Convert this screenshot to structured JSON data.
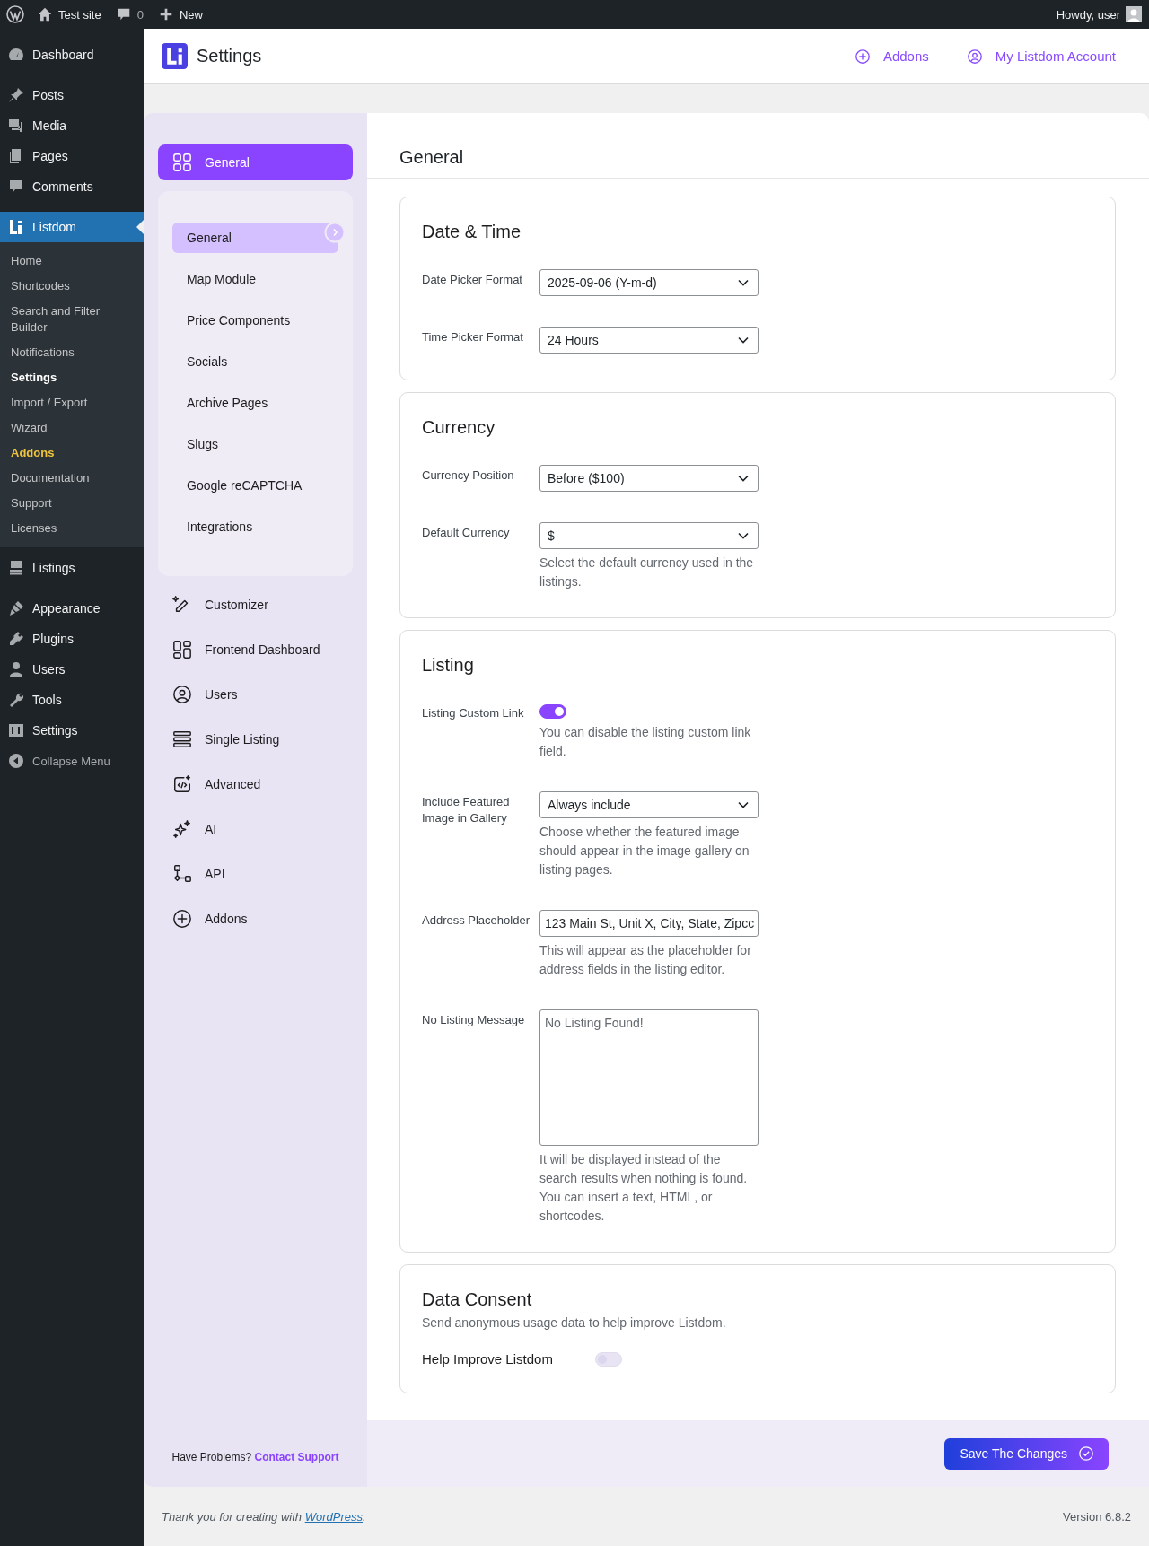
{
  "admin_bar": {
    "site": "Test site",
    "comments": "0",
    "new": "New",
    "greeting": "Howdy, user"
  },
  "admin_menu": [
    {
      "label": "Dashboard",
      "selected": false
    },
    {
      "label": "Posts",
      "selected": false
    },
    {
      "label": "Media",
      "selected": false
    },
    {
      "label": "Pages",
      "selected": false
    },
    {
      "label": "Comments",
      "selected": false
    },
    {
      "label": "Listdom",
      "selected": true,
      "children": [
        {
          "label": "Home",
          "selected": false,
          "kind": "link"
        },
        {
          "label": "Shortcodes",
          "selected": false,
          "kind": "link"
        },
        {
          "label": "Search and Filter Builder",
          "selected": false,
          "kind": "link"
        },
        {
          "label": "Notifications",
          "selected": false,
          "kind": "link"
        },
        {
          "label": "Settings",
          "selected": true,
          "kind": "link"
        },
        {
          "label": "Import / Export",
          "selected": false,
          "kind": "link"
        },
        {
          "label": "Wizard",
          "selected": false,
          "kind": "link"
        },
        {
          "label": "Addons",
          "selected": false,
          "kind": "highlight"
        },
        {
          "label": "Documentation",
          "selected": false,
          "kind": "link"
        },
        {
          "label": "Support",
          "selected": false,
          "kind": "link"
        },
        {
          "label": "Licenses",
          "selected": false,
          "kind": "link"
        }
      ]
    },
    {
      "label": "Listings",
      "selected": false
    },
    {
      "label": "Appearance",
      "selected": false
    },
    {
      "label": "Plugins",
      "selected": false
    },
    {
      "label": "Users",
      "selected": false
    },
    {
      "label": "Tools",
      "selected": false
    },
    {
      "label": "Settings",
      "selected": false
    },
    {
      "label": "Collapse Menu",
      "selected": false
    }
  ],
  "header": {
    "title": "Settings",
    "links": [
      {
        "label": "Addons"
      },
      {
        "label": "My Listdom Account"
      }
    ]
  },
  "nav": {
    "sections": [
      {
        "label": "General",
        "selected": true,
        "children": [
          {
            "label": "General",
            "selected": true
          },
          {
            "label": "Map Module",
            "selected": false
          },
          {
            "label": "Price Components",
            "selected": false
          },
          {
            "label": "Socials",
            "selected": false
          },
          {
            "label": "Archive Pages",
            "selected": false
          },
          {
            "label": "Slugs",
            "selected": false
          },
          {
            "label": "Google reCAPTCHA",
            "selected": false
          },
          {
            "label": "Integrations",
            "selected": false
          }
        ]
      },
      {
        "label": "Customizer",
        "selected": false
      },
      {
        "label": "Frontend Dashboard",
        "selected": false
      },
      {
        "label": "Users",
        "selected": false
      },
      {
        "label": "Single Listing",
        "selected": false
      },
      {
        "label": "Advanced",
        "selected": false
      },
      {
        "label": "AI",
        "selected": false
      },
      {
        "label": "API",
        "selected": false
      },
      {
        "label": "Addons",
        "selected": false
      }
    ],
    "help": {
      "text": "Have Problems?",
      "link": "Contact Support"
    }
  },
  "content": {
    "title": "General",
    "cards": [
      {
        "title": "Date & Time",
        "fields": [
          {
            "kind": "select",
            "label": "Date Picker Format",
            "value": "2025-09-06 (Y-m-d)"
          },
          {
            "kind": "select",
            "label": "Time Picker Format",
            "value": "24 Hours"
          }
        ]
      },
      {
        "title": "Currency",
        "fields": [
          {
            "kind": "select",
            "label": "Currency Position",
            "value": "Before ($100)"
          },
          {
            "kind": "select",
            "label": "Default Currency",
            "value": "$",
            "help": "Select the default currency used in the listings."
          }
        ]
      },
      {
        "title": "Listing",
        "fields": [
          {
            "kind": "toggle",
            "label": "Listing Custom Link",
            "on": true,
            "help": "You can disable the listing custom link field."
          },
          {
            "kind": "select",
            "label": "Include Featured Image in Gallery",
            "value": "Always include",
            "help": "Choose whether the featured image should appear in the image gallery on listing pages."
          },
          {
            "kind": "text",
            "label": "Address Placeholder",
            "value": "123 Main St, Unit X, City, State, Zipcc",
            "help": "This will appear as the placeholder for address fields in the listing editor."
          },
          {
            "kind": "textarea",
            "label": "No Listing Message",
            "value": "No Listing Found!",
            "help": "It will be displayed instead of the search results when nothing is found. You can insert a text, HTML, or shortcodes."
          }
        ]
      },
      {
        "title": "Data Consent",
        "description": "Send anonymous usage data to help improve Listdom.",
        "fields": [
          {
            "kind": "consent",
            "label": "Help Improve Listdom",
            "on": false
          }
        ]
      }
    ]
  },
  "save_button": "Save The Changes",
  "footer": {
    "text": "Thank you for creating with",
    "link": "WordPress",
    "after": ".",
    "version": "Version 6.8.2"
  }
}
